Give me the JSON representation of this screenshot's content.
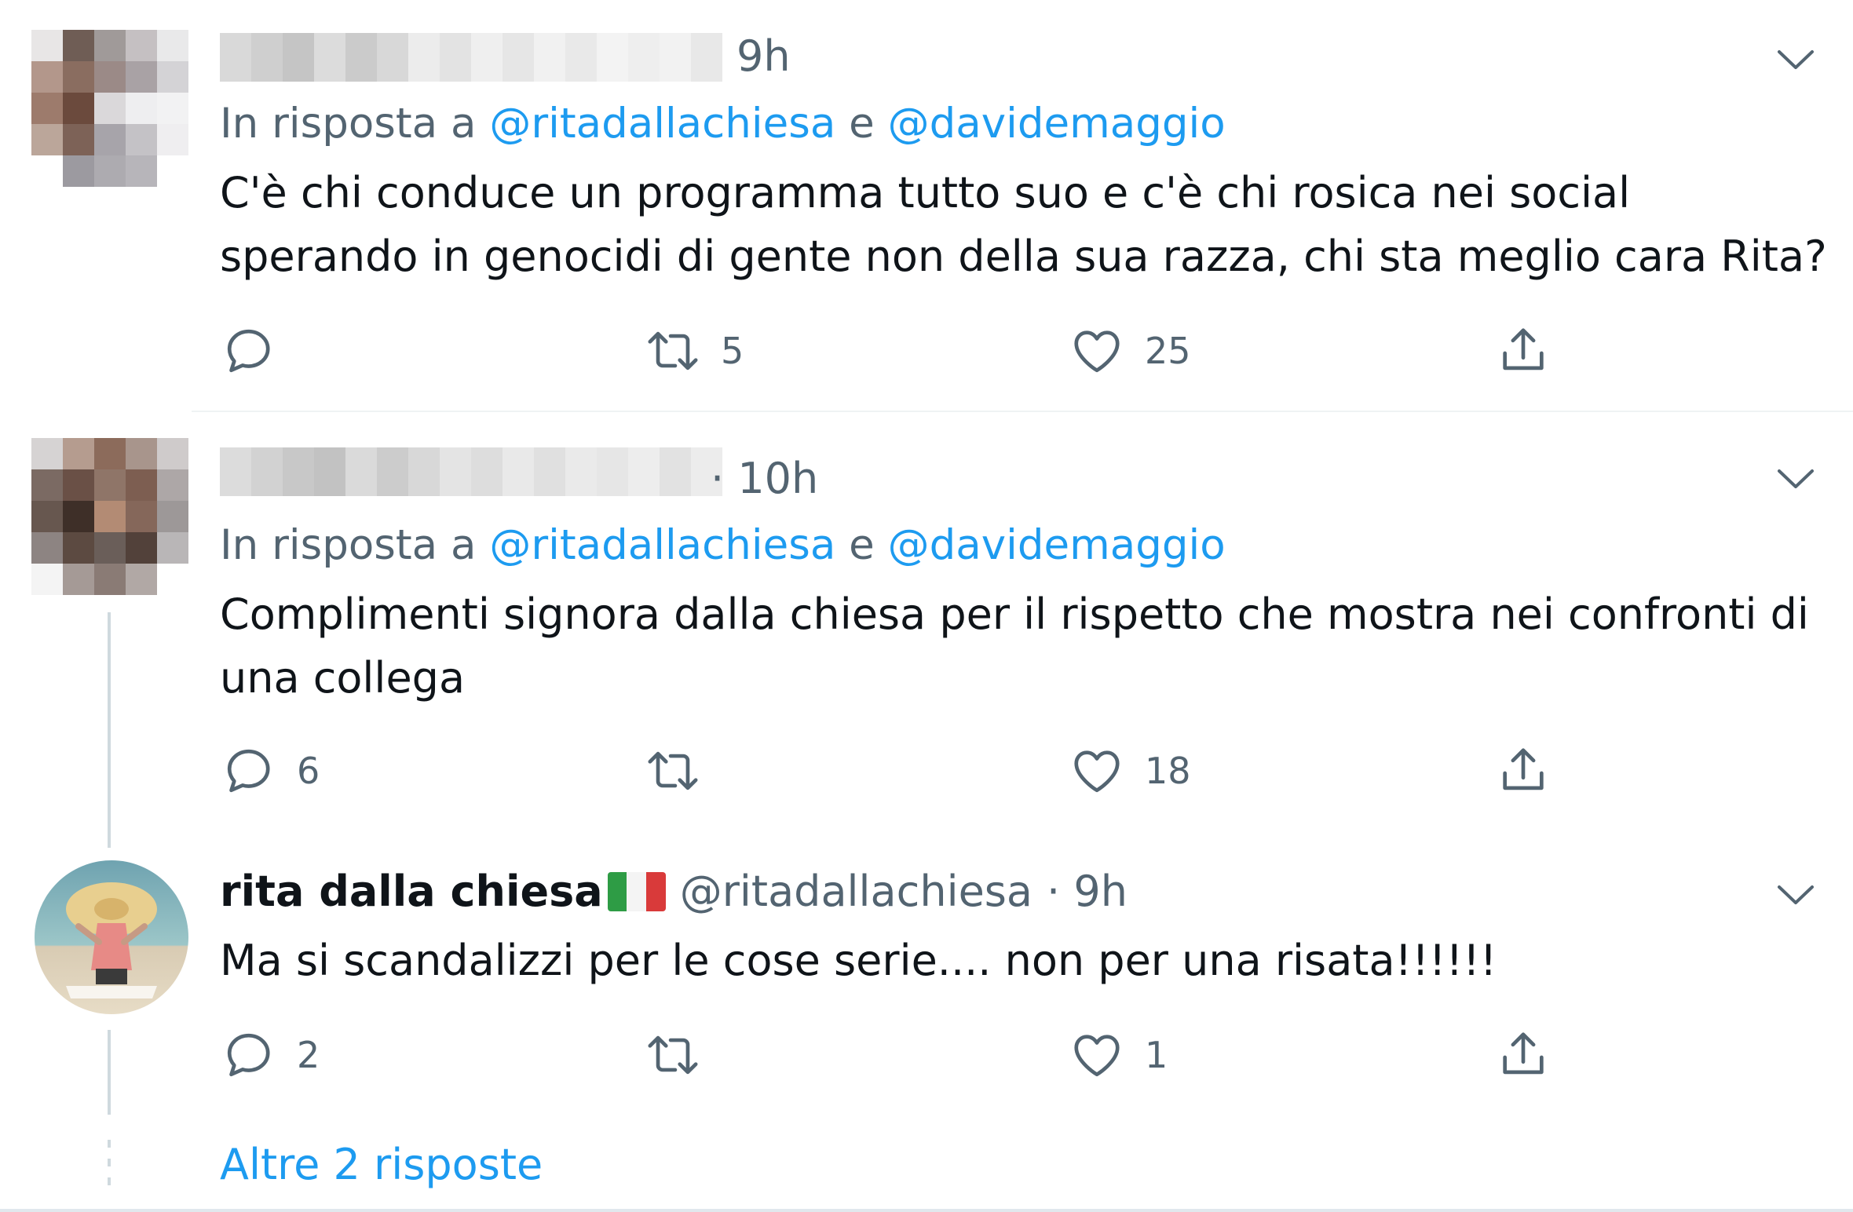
{
  "tweets": [
    {
      "time": "9h",
      "reply_prefix": "In risposta a",
      "mention1": "@ritadallachiesa",
      "conj": "e",
      "mention2": "@davidemaggio",
      "text": "C'è chi conduce un programma tutto suo e c'è chi rosica nei social sperando in genocidi di gente non della sua razza, chi sta meglio cara Rita?",
      "replies": "",
      "retweets": "5",
      "likes": "25"
    },
    {
      "time": "· 10h",
      "reply_prefix": "In risposta a",
      "mention1": "@ritadallachiesa",
      "conj": "e",
      "mention2": "@davidemaggio",
      "text": "Complimenti signora dalla chiesa per il rispetto che mostra nei confronti di una collega",
      "replies": "6",
      "retweets": "",
      "likes": "18"
    },
    {
      "display_name": "rita dalla chiesa",
      "flag": "italy-flag",
      "handle": "@ritadallachiesa",
      "time": "· 9h",
      "text": "Ma si scandalizzi per le cose serie.... non per una risata!!!!!!",
      "replies": "2",
      "retweets": "",
      "likes": "1"
    }
  ],
  "more_replies": "Altre 2 risposte",
  "colors": {
    "accent": "#1d9bf0",
    "secondary_text": "#536471",
    "primary_text": "#0f1419",
    "line": "#cfd9de"
  }
}
